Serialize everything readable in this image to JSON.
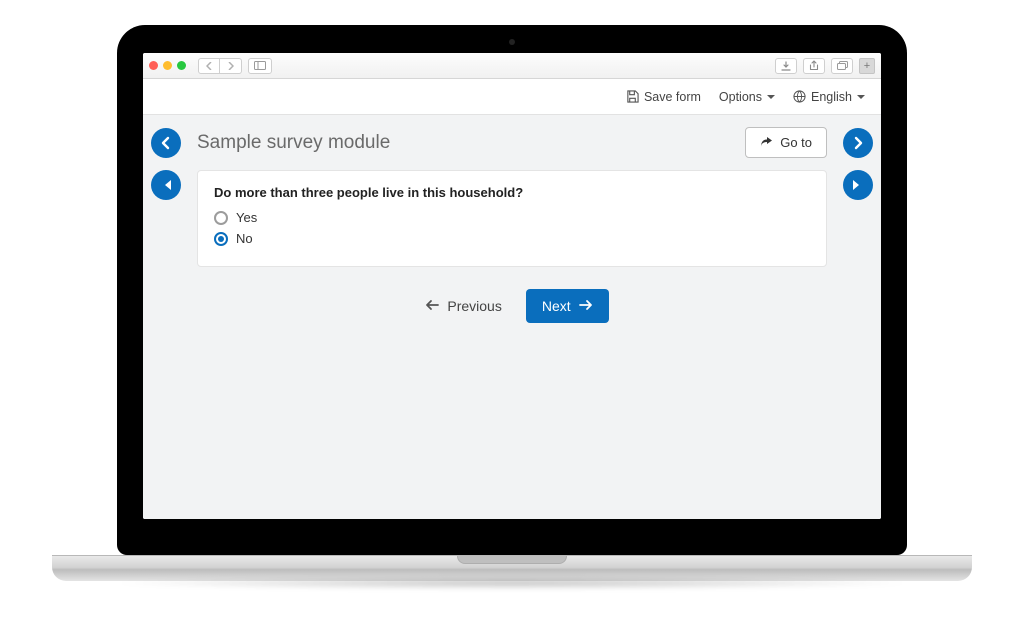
{
  "toolbar": {
    "save_label": "Save form",
    "options_label": "Options",
    "language_label": "English"
  },
  "survey": {
    "title": "Sample survey module",
    "goto_label": "Go to",
    "question": "Do more than three people live in this household?",
    "options": [
      {
        "label": "Yes",
        "selected": false
      },
      {
        "label": "No",
        "selected": true
      }
    ]
  },
  "pager": {
    "previous_label": "Previous",
    "next_label": "Next"
  }
}
